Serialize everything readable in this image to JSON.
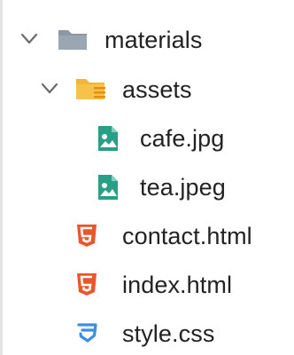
{
  "tree": {
    "items": [
      {
        "label": "materials",
        "type": "folder",
        "expanded": true,
        "icon": "folder-icon",
        "color": "#8b98a5"
      },
      {
        "label": "assets",
        "type": "folder",
        "expanded": true,
        "icon": "assets-folder-icon",
        "color": "#f2b535"
      },
      {
        "label": "cafe.jpg",
        "type": "file",
        "icon": "image-file-icon",
        "color": "#27a085"
      },
      {
        "label": "tea.jpeg",
        "type": "file",
        "icon": "image-file-icon",
        "color": "#27a085"
      },
      {
        "label": "contact.html",
        "type": "file",
        "icon": "html5-icon",
        "color": "#e8572a"
      },
      {
        "label": "index.html",
        "type": "file",
        "icon": "html5-icon",
        "color": "#e8572a"
      },
      {
        "label": "style.css",
        "type": "file",
        "icon": "css3-icon",
        "color": "#3d8de0"
      }
    ]
  }
}
